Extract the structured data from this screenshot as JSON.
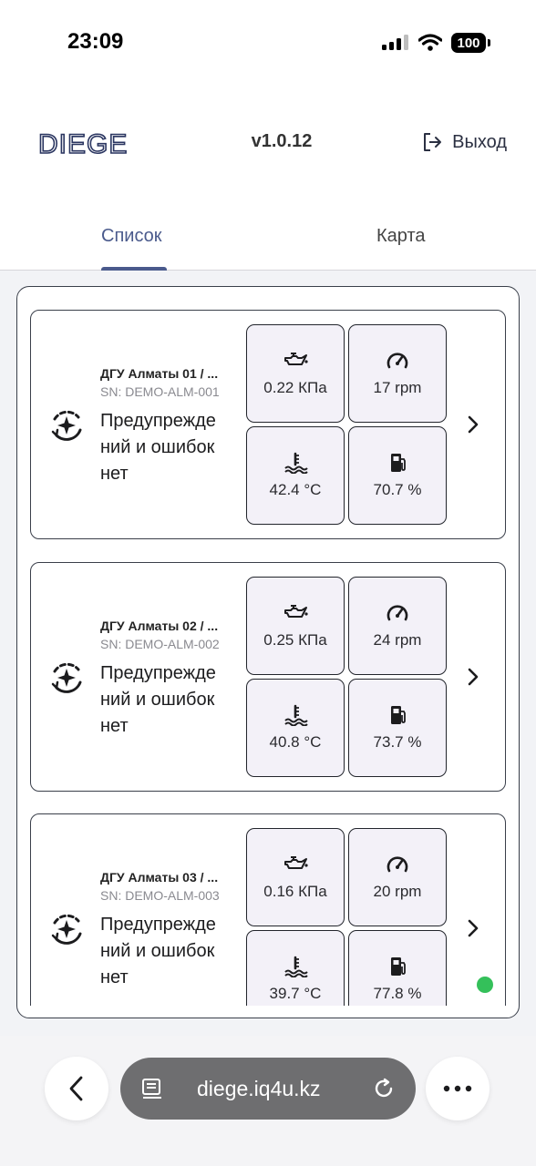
{
  "status_bar": {
    "time": "23:09",
    "battery": "100"
  },
  "header": {
    "logo_text": "DIEGE",
    "version": "v1.0.12",
    "logout_label": "Выход"
  },
  "tabs": [
    {
      "label": "Список",
      "active": true
    },
    {
      "label": "Карта",
      "active": false
    }
  ],
  "devices": [
    {
      "title": "ДГУ Алматы 01 / ...",
      "sn": "SN: DEMO-ALM-001",
      "status": "Предупрежде ний и ошибок нет",
      "oil_pressure": "0.22 КПа",
      "rpm": "17 rpm",
      "coolant_temp": "42.4 °C",
      "fuel": "70.7 %"
    },
    {
      "title": "ДГУ Алматы 02 / ...",
      "sn": "SN: DEMO-ALM-002",
      "status": "Предупрежде ний и ошибок нет",
      "oil_pressure": "0.25 КПа",
      "rpm": "24 rpm",
      "coolant_temp": "40.8 °C",
      "fuel": "73.7 %"
    },
    {
      "title": "ДГУ Алматы 03 / ...",
      "sn": "SN: DEMO-ALM-003",
      "status": "Предупрежде ний и ошибок нет",
      "oil_pressure": "0.16 КПа",
      "rpm": "20 rpm",
      "coolant_temp": "39.7 °C",
      "fuel": "77.8 %"
    }
  ],
  "browser": {
    "url": "diege.iq4u.kz"
  },
  "colors": {
    "accent": "#4a5a8c",
    "metric_bg": "#f3f1f8",
    "online": "#34c05a",
    "url_pill": "#6e6e70"
  },
  "icons": [
    "signal-icon",
    "wifi-icon",
    "logout-icon",
    "engine-status-icon",
    "oil-pressure-icon",
    "speedometer-icon",
    "coolant-temperature-icon",
    "fuel-icon",
    "chevron-right-icon",
    "back-arrow-icon",
    "reader-icon",
    "reload-icon",
    "more-icon"
  ]
}
